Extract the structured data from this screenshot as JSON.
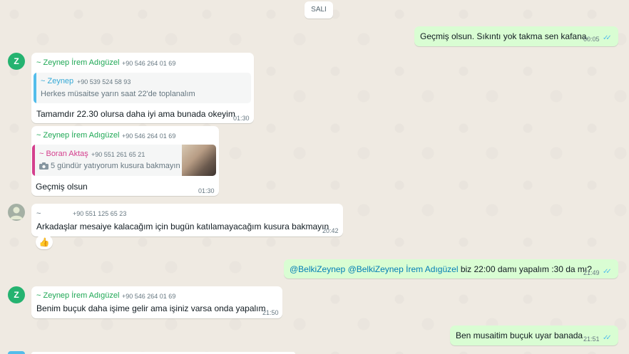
{
  "chat": {
    "day_label": "SALI",
    "messages": [
      {
        "text": "Geçmiş olsun. Sıkıntı yok takma sen kafana.",
        "time": "00:05",
        "ticks": "✓✓"
      },
      {
        "sender": "~ Zeynep İrem Adıgüzel",
        "phone": "+90 546 264 01 69",
        "avatar": "Z",
        "quote": {
          "name": "~ Zeynep",
          "phone": "+90 539 524 58 93",
          "text": "Herkes müsaitse yarın saat 22'de toplanalım"
        },
        "text": "Tamamdır 22.30 olursa daha iyi ama bunada okeyim",
        "time": "01:30"
      },
      {
        "sender": "~ Zeynep İrem Adıgüzel",
        "phone": "+90 546 264 01 69",
        "quote": {
          "name": "~ Boran Aktaş",
          "phone": "+90 551 261 65 21",
          "text": "5 gündür yatıyorum kusura bakmayın"
        },
        "text": "Geçmiş olsun",
        "time": "01:30"
      },
      {
        "sender": "~ ",
        "phone": "+90 551 125 65 23",
        "text": "Arkadaşlar mesaiye kalacağım için bugün katılamayacağım kusura bakmayın",
        "time": "20:42",
        "reaction": "👍"
      },
      {
        "mention1": "@BelkiZeynep",
        "mention2": "@BelkiZeynep İrem Adıgüzel",
        "text": " biz 22:00 damı yapalım :30 da mı?",
        "time": "21:49",
        "ticks": "✓✓"
      },
      {
        "sender": "~ Zeynep İrem Adıgüzel",
        "phone": "+90 546 264 01 69",
        "avatar": "Z",
        "text": "Benim buçuk daha işime gelir ama işiniz varsa onda yapalım",
        "time": "21:50"
      },
      {
        "text": "Ben musaitim buçuk uyar banada",
        "time": "21:51",
        "ticks": "✓✓"
      }
    ]
  },
  "colors": {
    "background": "#efeae2",
    "outgoing": "#d9fdd3",
    "incoming": "#ffffff",
    "sender": "#1fa855",
    "tick": "#53bdeb"
  },
  "icons": {
    "camera": "camera-icon",
    "avatar_default": "person-icon"
  }
}
